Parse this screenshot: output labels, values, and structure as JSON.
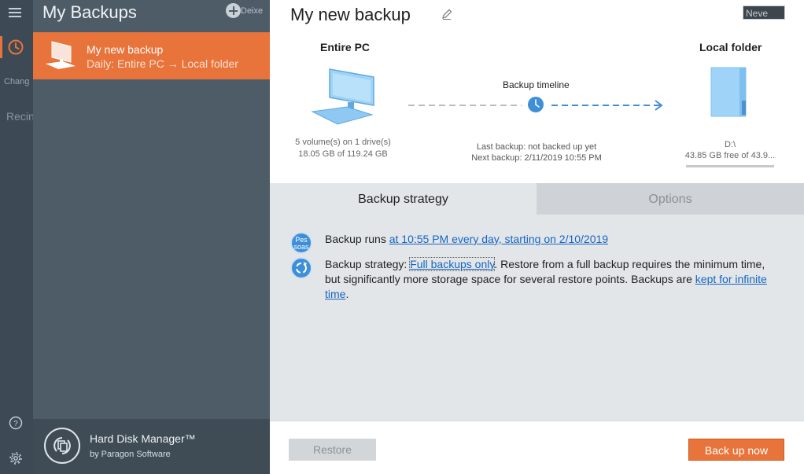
{
  "rail": {
    "tab_label": "Chang",
    "secondary_label": "Recinto"
  },
  "panel": {
    "title": "My Backups",
    "add_label": "Deixe",
    "items": [
      {
        "name": "My new backup",
        "subtitle": "Daily: Entire PC → Local folder"
      }
    ],
    "footer": {
      "product": "Hard Disk Manager™",
      "by": "by Paragon Software"
    }
  },
  "main": {
    "title": "My new backup",
    "never_badge": "Neve",
    "source": {
      "title": "Entire PC",
      "info": "5 volume(s) on 1 drive(s) 18.05 GB of 119.24 GB"
    },
    "timeline": {
      "label": "Backup timeline",
      "last": "Last backup: not backed up yet",
      "next": "Next backup: 2/11/2019 10:55 PM"
    },
    "destination": {
      "title": "Local folder",
      "drive": "D:\\",
      "free": "43.85 GB free of 43.9..."
    },
    "tabs": [
      {
        "label": "Backup strategy",
        "active": true
      },
      {
        "label": "Options",
        "active": false
      }
    ],
    "strategy": {
      "row1_icon_text": "Pes soas",
      "row1_prefix": "Backup runs ",
      "row1_link": "at 10:55 PM every day, starting on 2/10/2019",
      "row2_prefix": "Backup strategy: ",
      "row2_link": "Full backups only",
      "row2_middle": ". Restore from a full backup requires the minimum time, but significantly more storage space for several restore points. Backups are ",
      "row2_link2": "kept for infinite time",
      "row2_end": "."
    },
    "footer": {
      "restore_label": "Restore",
      "backup_now_label": "Back up now"
    }
  },
  "colors": {
    "accent": "#e8743b",
    "rail": "#3d4a55",
    "panel": "#4d5c67",
    "link": "#1565c0",
    "icon_blue": "#3f8fd8"
  }
}
